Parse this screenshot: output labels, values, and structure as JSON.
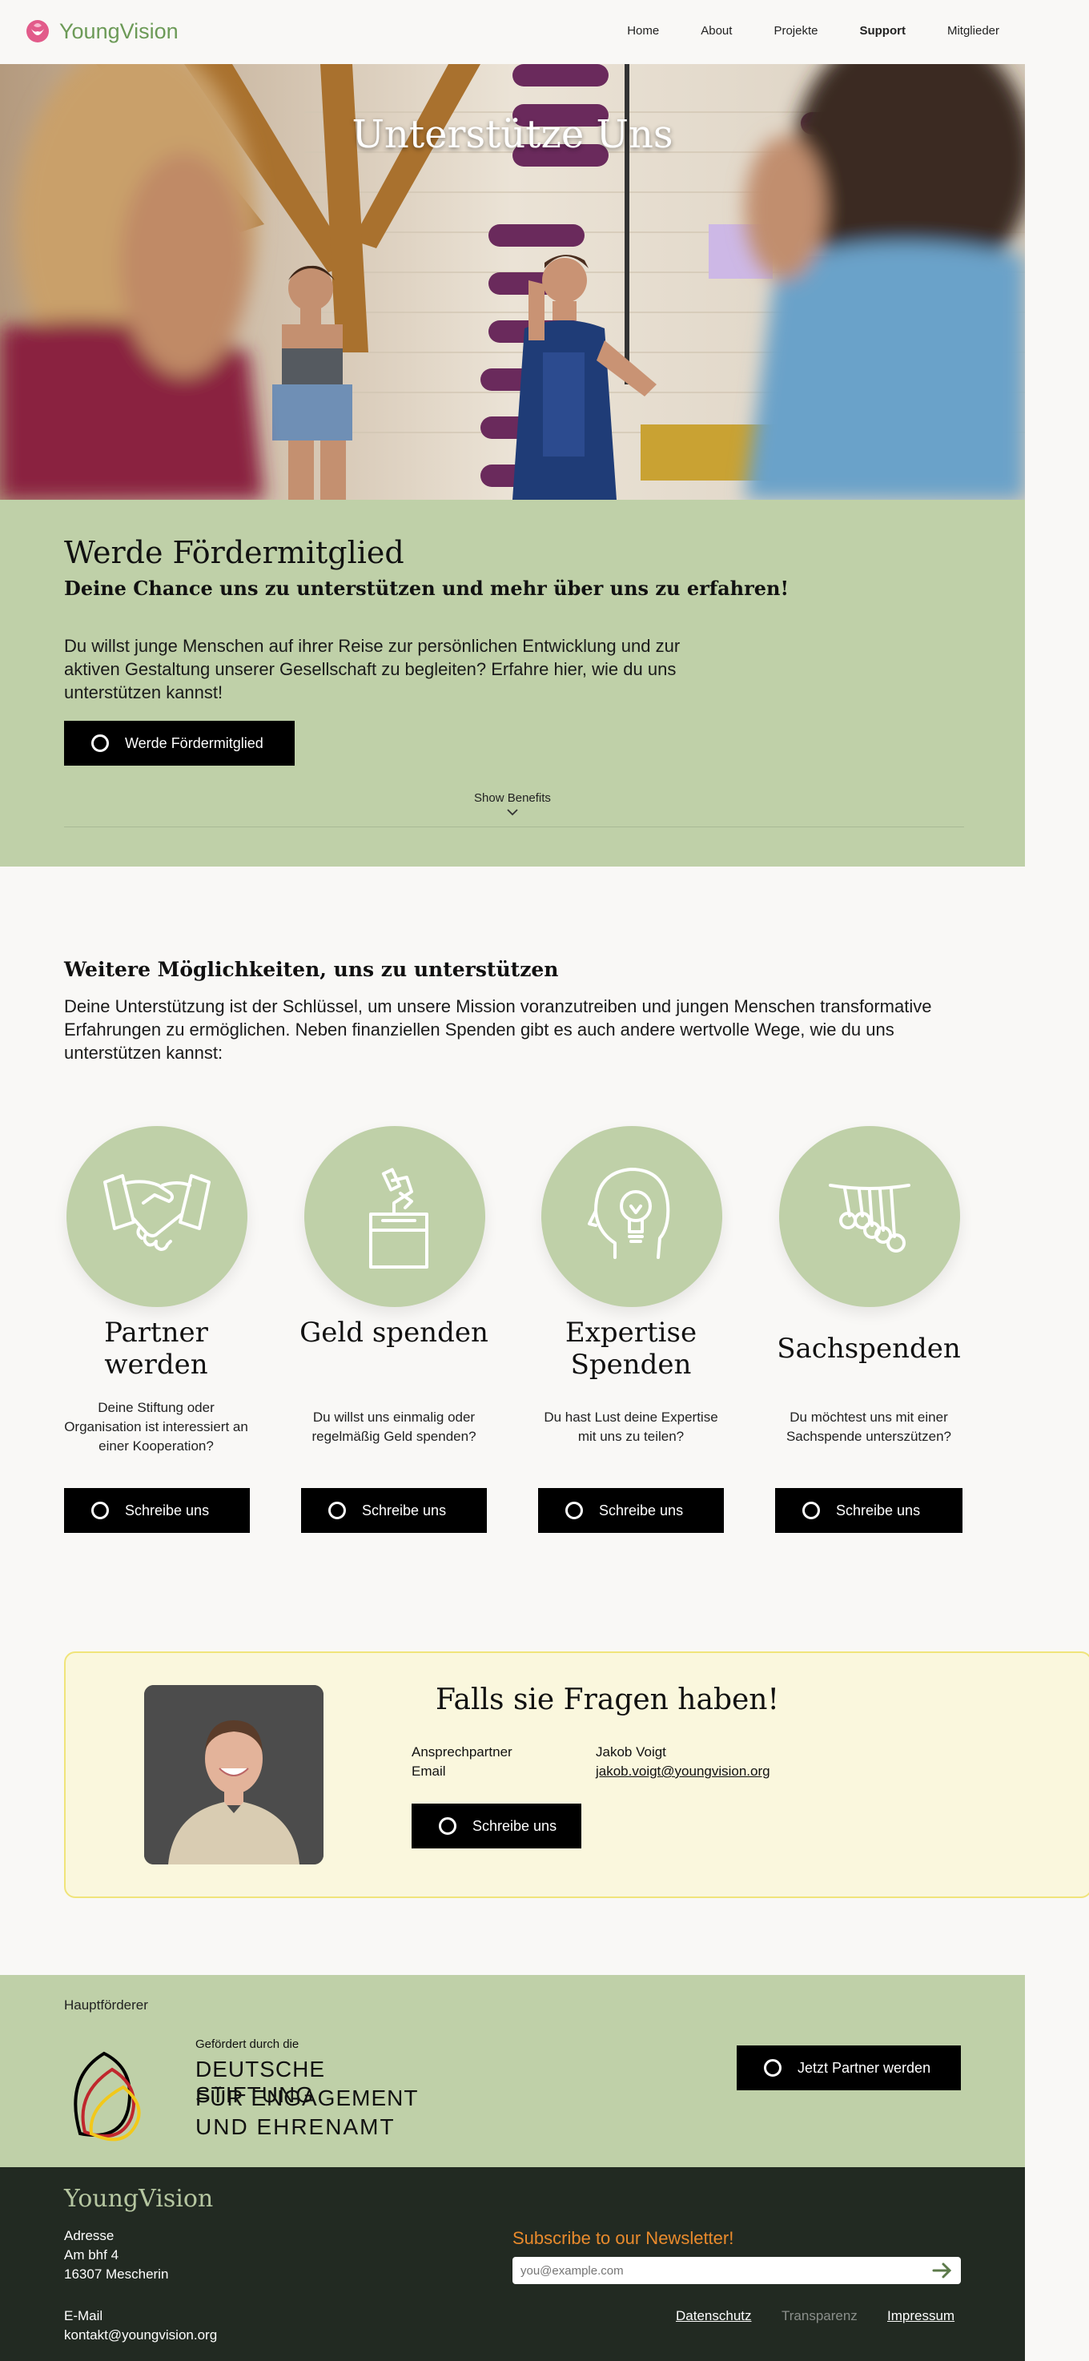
{
  "header": {
    "logo_text": "YoungVision",
    "nav": [
      "Home",
      "About",
      "Projekte",
      "Support",
      "Mitglieder"
    ],
    "active_nav": "Support"
  },
  "hero": {
    "title": "Unterstütze Uns"
  },
  "membership": {
    "title": "Werde Fördermitglied",
    "subtitle": "Deine Chance uns zu unterstützen und mehr über uns zu erfahren!",
    "text": "Du willst junge Menschen auf ihrer Reise zur persönlichen Entwicklung und zur aktiven Gestaltung unserer Gesellschaft zu begleiten? Erfahre hier, wie du uns unterstützen kannst!",
    "button": "Werde Fördermitglied",
    "show_benefits": "Show Benefits"
  },
  "ways": {
    "title": "Weitere Möglichkeiten, uns zu unterstützen",
    "text": "Deine Unterstützung ist der Schlüssel, um unsere Mission voranzutreiben und jungen Menschen transformative Erfahrungen zu ermöglichen. Neben finanziellen Spenden gibt es auch andere wertvolle Wege, wie du uns unterstützen kannst:",
    "cards": [
      {
        "icon": "handshake-icon",
        "title": "Partner werden",
        "text": "Deine Stiftung oder Organisation ist interessiert an einer Kooperation?",
        "button": "Schreibe uns"
      },
      {
        "icon": "donation-box-icon",
        "title": "Geld spenden",
        "text": "Du willst uns einmalig oder regelmäßig Geld spenden?",
        "button": "Schreibe uns"
      },
      {
        "icon": "lightbulb-head-icon",
        "title": "Expertise Spenden",
        "text": "Du hast Lust deine Expertise mit uns zu teilen?",
        "button": "Schreibe uns"
      },
      {
        "icon": "newtons-cradle-icon",
        "title": "Sachspenden",
        "text": "Du möchtest uns mit einer Sachspende unterszützen?",
        "button": "Schreibe uns"
      }
    ]
  },
  "contact": {
    "title": "Falls sie Fragen haben!",
    "label_person": "Ansprechpartner",
    "label_email": "Email",
    "person": "Jakob Voigt",
    "email": "jakob.voigt@youngvision.org",
    "button": "Schreibe uns"
  },
  "sponsor": {
    "heading": "Hauptförderer",
    "logo_small": "Gefördert durch die",
    "logo_line1": "DEUTSCHE STIFTUNG",
    "logo_line2": "FÜR ENGAGEMENT",
    "logo_line3": "UND EHRENAMT",
    "button": "Jetzt Partner werden"
  },
  "footer": {
    "logo": "YoungVision",
    "address_label": "Adresse",
    "address_line1": "Am bhf 4",
    "address_line2": "16307 Mescherin",
    "email_label": "E-Mail",
    "email": "kontakt@youngvision.org",
    "newsletter_title": "Subscribe to our Newsletter!",
    "newsletter_placeholder": "you@example.com",
    "links": [
      "Datenschutz",
      "Transparenz",
      "Impressum"
    ]
  },
  "colors": {
    "green": "#bfd0a8",
    "dark": "#222a22",
    "accent_orange": "#e98a2c",
    "contact_bg": "#faf7dd",
    "logo_green": "#6c9a57"
  }
}
